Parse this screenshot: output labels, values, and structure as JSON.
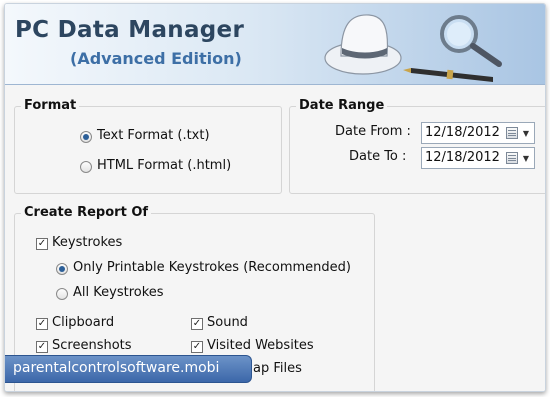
{
  "header": {
    "title": "PC Data Manager",
    "subtitle": "(Advanced Edition)",
    "artwork": [
      "hat-icon",
      "magnifier-icon",
      "pen-icon"
    ]
  },
  "format": {
    "legend": "Format",
    "options": [
      {
        "label": "Text Format (.txt)",
        "selected": true
      },
      {
        "label": "HTML Format (.html)",
        "selected": false
      }
    ]
  },
  "date_range": {
    "legend": "Date Range",
    "from_label": "Date From :",
    "from_value": "12/18/2012",
    "to_label": "Date To :",
    "to_value": "12/18/2012"
  },
  "report": {
    "legend": "Create Report Of",
    "keystrokes": {
      "label": "Keystrokes",
      "checked": true
    },
    "keystroke_options": [
      {
        "label": "Only Printable Keystrokes (Recommended)",
        "selected": true
      },
      {
        "label": "All Keystrokes",
        "selected": false
      }
    ],
    "items": [
      {
        "label": "Clipboard",
        "checked": true
      },
      {
        "label": "Sound",
        "checked": true
      },
      {
        "label": "Screenshots",
        "checked": true
      },
      {
        "label": "Visited Websites",
        "checked": true
      },
      {
        "label": "Files",
        "partial_text": "ap Files",
        "checked": true
      }
    ]
  },
  "watermark": {
    "text": "parentalcontrolsoftware.mobi"
  },
  "colors": {
    "accent": "#2c5f98",
    "title": "#2d4660",
    "subtitle": "#3d6fa6",
    "banner": "#3c67a9"
  }
}
